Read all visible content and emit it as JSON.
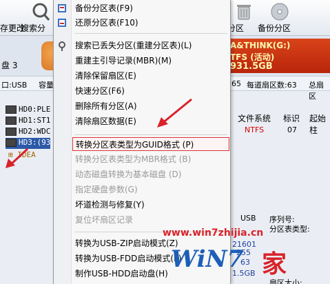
{
  "toolbar": {
    "left_label": "存更改",
    "search_label": "搜索分",
    "right1_label": "分区",
    "right2_label": "备份分区"
  },
  "disk": {
    "label": "盘 3",
    "partition_name": "A&THINK(G:)",
    "partition_fs": "TFS (活动)",
    "partition_size": "931.5GB"
  },
  "infobar": {
    "iface": "口:USB",
    "capacity": "容量",
    "n65": "65",
    "sectors_per_track": "每道扇区数:63",
    "total_sectors": "总扇区"
  },
  "tree": {
    "items": [
      {
        "label": "HD0:PLE"
      },
      {
        "label": "HD1:ST1"
      },
      {
        "label": "HD2:WDC"
      },
      {
        "label": "HD3:(93"
      }
    ],
    "sub": "IDEA"
  },
  "table": {
    "headers": [
      "文件系统",
      "标识",
      "起始柱"
    ],
    "row": {
      "fs": "NTFS",
      "id": "07"
    }
  },
  "bottom_info": {
    "usb": "USB",
    "serial_label": "序列号:",
    "parttype_label": "分区表类型:",
    "n1": "21601",
    "n2": "255",
    "n3": "63",
    "size": "1.5GB",
    "sector_label": "扇区大小:"
  },
  "menu": {
    "items": [
      {
        "label": "备份分区表(F9)",
        "disabled": false
      },
      {
        "label": "还原分区表(F10)",
        "disabled": false
      },
      {
        "label": "搜索已丢失分区(重建分区表)(L)",
        "disabled": false
      },
      {
        "label": "重建主引导记录(MBR)(M)",
        "disabled": false
      },
      {
        "label": "清除保留扇区(E)",
        "disabled": false
      },
      {
        "label": "快速分区(F6)",
        "disabled": false
      },
      {
        "label": "删除所有分区(A)",
        "disabled": false
      },
      {
        "label": "清除扇区数据(E)",
        "disabled": false
      },
      {
        "label": "转换分区表类型为GUID格式 (P)",
        "disabled": false
      },
      {
        "label": "转换分区表类型为MBR格式 (B)",
        "disabled": true
      },
      {
        "label": "动态磁盘转换为基本磁盘 (D)",
        "disabled": true
      },
      {
        "label": "指定硬盘参数(G)",
        "disabled": true
      },
      {
        "label": "坏道检测与修复(Y)",
        "disabled": false
      },
      {
        "label": "复位坏扇区记录",
        "disabled": true
      },
      {
        "label": "转换为USB-ZIP启动模式(Z)",
        "disabled": false
      },
      {
        "label": "转换为USB-FDD启动模式(F)",
        "disabled": false
      },
      {
        "label": "制作USB-HDD启动盘(H)",
        "disabled": false
      }
    ]
  },
  "watermark": {
    "url": "www.win7zhijia.cn",
    "logo": "WiN7",
    "home": "家"
  },
  "colors": {
    "accent_red": "#d8333a",
    "selection_blue": "#2d5aa7",
    "partition_orange": "#c8360f"
  }
}
